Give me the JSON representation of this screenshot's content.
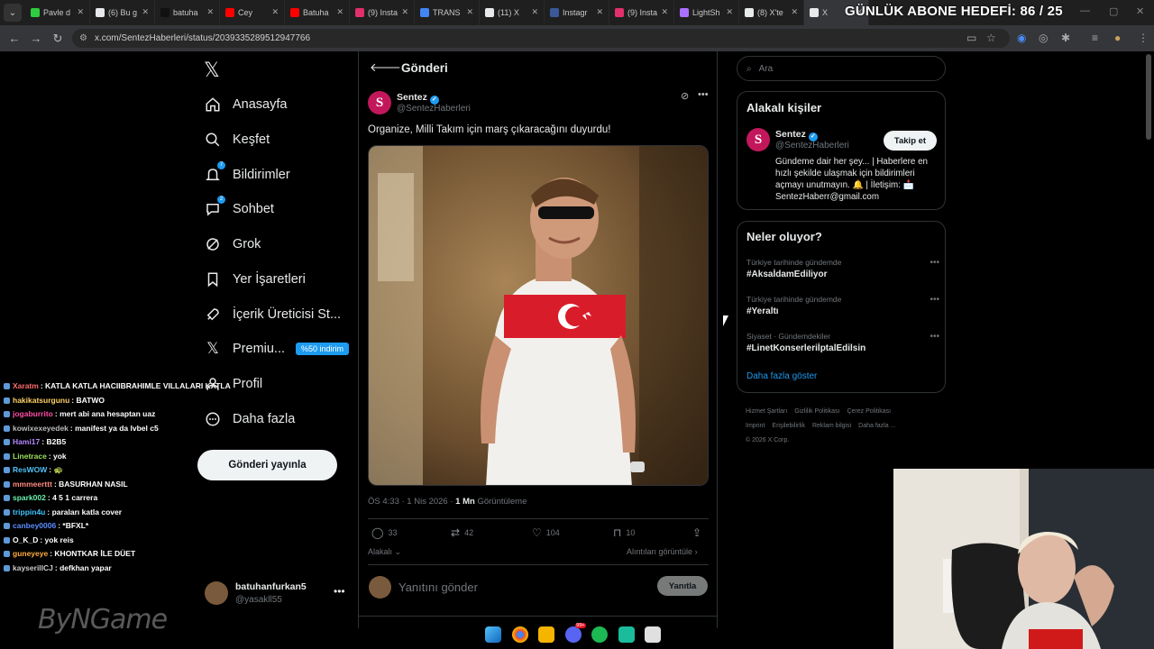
{
  "browser": {
    "tabs": [
      {
        "label": "Pavle d",
        "color": "#2ecc40"
      },
      {
        "label": "(6) Bu g",
        "color": "#e7e9ea"
      },
      {
        "label": "batuha",
        "color": "#111111"
      },
      {
        "label": "Cey",
        "color": "#ff0000"
      },
      {
        "label": "Batuha",
        "color": "#ff0000"
      },
      {
        "label": "(9) Insta",
        "color": "#e1306c"
      },
      {
        "label": "TRANS",
        "color": "#4285f4"
      },
      {
        "label": "(11) X",
        "color": "#e7e9ea"
      },
      {
        "label": "Instagr",
        "color": "#3b5998"
      },
      {
        "label": "(9) Insta",
        "color": "#e1306c"
      },
      {
        "label": "LightSh",
        "color": "#a970ff"
      },
      {
        "label": "(8) X'te",
        "color": "#e7e9ea"
      },
      {
        "label": "X",
        "color": "#e7e9ea"
      }
    ],
    "url": "x.com/SentezHaberleri/status/2039335289512947766",
    "overlay_title": "GÜNLÜK ABONE HEDEFİ: 86 / 25"
  },
  "chat": [
    {
      "user": "Xaratm",
      "msg": "KATLA KATLA HACIIBRAHIMLE VILLALARI KATLA",
      "color": "#ff6b6b"
    },
    {
      "user": "hakikatsurgunu",
      "msg": "BATWO",
      "color": "#ffd166"
    },
    {
      "user": "jogaburrito",
      "msg": "mert abi ana hesaptan uaz",
      "color": "#ff4da6"
    },
    {
      "user": "kowixexeyedek",
      "msg": "manifest ya da lvbel c5",
      "color": "#bbbbbb"
    },
    {
      "user": "Hami17",
      "msg": "B2B5",
      "color": "#b388ff"
    },
    {
      "user": "Linetrace",
      "msg": "yok",
      "color": "#9be15d"
    },
    {
      "user": "ResWOW",
      "msg": "🐢",
      "color": "#4fc3f7"
    },
    {
      "user": "mmmeerttt",
      "msg": "BASURHAN NASIL",
      "color": "#ff8a80"
    },
    {
      "user": "spark002",
      "msg": "4 5 1 carrera",
      "color": "#69f0ae"
    },
    {
      "user": "trippin4u",
      "msg": "paraları katla cover",
      "color": "#40c4ff"
    },
    {
      "user": "canbey0006",
      "msg": "*BFXL*",
      "color": "#5c8dff"
    },
    {
      "user": "O_K_D",
      "msg": "yok reis",
      "color": "#ffffff"
    },
    {
      "user": "guneyeye",
      "msg": "KHONTKAR İLE DÜET",
      "color": "#ffab40"
    },
    {
      "user": "kayserilICJ",
      "msg": "defkhan yapar",
      "color": "#cccccc"
    }
  ],
  "watermark": "ByNGame",
  "nav": {
    "items": [
      {
        "label": "Anasayfa",
        "icon": "home-icon"
      },
      {
        "label": "Keşfet",
        "icon": "search-icon"
      },
      {
        "label": "Bildirimler",
        "icon": "bell-icon",
        "badge": "7"
      },
      {
        "label": "Sohbet",
        "icon": "chat-icon",
        "badge": "2"
      },
      {
        "label": "Grok",
        "icon": "grok-icon"
      },
      {
        "label": "Yer İşaretleri",
        "icon": "bookmark-icon"
      },
      {
        "label": "İçerik Üreticisi St...",
        "icon": "rocket-icon"
      },
      {
        "label": "Premiu...",
        "icon": "x-icon",
        "promo": "%50 indirim"
      },
      {
        "label": "Profil",
        "icon": "person-icon"
      },
      {
        "label": "Daha fazla",
        "icon": "more-circle-icon"
      }
    ],
    "post_button": "Gönderi yayınla",
    "account": {
      "name": "batuhanfurkan5",
      "handle": "@yasakll55"
    }
  },
  "post": {
    "header": "Gönderi",
    "author_name": "Sentez",
    "author_handle": "@SentezHaberleri",
    "avatar_letter": "S",
    "text": "Organize, Milli Takım için marş çıkaracağını duyurdu!",
    "time": "ÖS 4:33 · 1 Nis 2026 · ",
    "views_count": "1 Mn",
    "views_label": " Görüntüleme",
    "replies": "33",
    "reposts": "42",
    "likes": "104",
    "bookmarks": "10",
    "related": "Alakalı",
    "quotes": "Alıntıları görüntüle",
    "reply_placeholder": "Yanıtını gönder",
    "reply_button": "Yanıtla"
  },
  "sidebar": {
    "search_placeholder": "Ara",
    "people_title": "Alakalı kişiler",
    "person": {
      "name": "Sentez",
      "handle": "@SentezHaberleri",
      "follow": "Takip et",
      "bio": "Gündeme dair her şey... | Haberlere en hızlı şekilde ulaşmak için bildirimleri açmayı unutmayın. 🔔 | İletişim: 📩 SentezHaberr@gmail.com"
    },
    "trends_title": "Neler oluyor?",
    "trends": [
      {
        "category": "Türkiye tarihinde gündemde",
        "name": "#AksaİdamEdiliyor"
      },
      {
        "category": "Türkiye tarihinde gündemde",
        "name": "#Yeraltı"
      },
      {
        "category": "Siyaset · Gündemdekiler",
        "name": "#LinetKonserleriİptalEdilsin"
      }
    ],
    "show_more": "Daha fazla göster",
    "footer_links": [
      "Hizmet Şartları",
      "Gizlilik Politikası",
      "Çerez Politikası",
      "Imprint",
      "Erişilebilirlik",
      "Reklam bilgisi",
      "Daha fazla ..."
    ],
    "copyright": "© 2026 X Corp."
  },
  "colors": {
    "accent": "#1d9bf0",
    "background": "#000000",
    "border": "#2f3336"
  },
  "taskbar": {
    "badge": "99+"
  }
}
